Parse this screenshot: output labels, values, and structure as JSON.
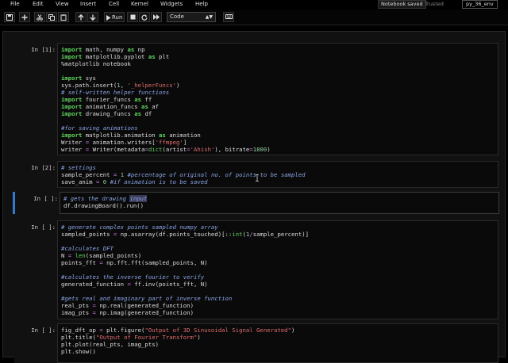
{
  "menubar": {
    "items": [
      "File",
      "Edit",
      "View",
      "Insert",
      "Cell",
      "Kernel",
      "Widgets",
      "Help"
    ],
    "notebook_status": "Notebook saved",
    "trusted": "Trusted",
    "kernel": "py_36_env"
  },
  "toolbar": {
    "run_label": "Run",
    "cell_type": "Code",
    "icons": [
      "save-icon",
      "add-cell-icon",
      "cut-icon",
      "copy-icon",
      "paste-icon",
      "move-up-icon",
      "move-down-icon",
      "run-icon",
      "stop-icon",
      "restart-icon",
      "fast-forward-icon",
      "keyboard-icon"
    ]
  },
  "cells": [
    {
      "prompt": "In [1]:",
      "lines": [
        [
          [
            "kw",
            "import"
          ],
          [
            "t",
            " math, numpy "
          ],
          [
            "kw",
            "as"
          ],
          [
            "t",
            " np"
          ]
        ],
        [
          [
            "kw",
            "import"
          ],
          [
            "t",
            " matplotlib.pyplot "
          ],
          [
            "kw",
            "as"
          ],
          [
            "t",
            " plt"
          ]
        ],
        [
          [
            "t",
            "%matplotlib notebook"
          ]
        ],
        [],
        [
          [
            "kw",
            "import"
          ],
          [
            "t",
            " sys"
          ]
        ],
        [
          [
            "t",
            "sys.path.insert("
          ],
          [
            "nm",
            "1"
          ],
          [
            "t",
            ", "
          ],
          [
            "st",
            "'_helperFuncs'"
          ],
          [
            "t",
            ")"
          ]
        ],
        [
          [
            "cm",
            "# self-written helper functions"
          ]
        ],
        [
          [
            "kw",
            "import"
          ],
          [
            "t",
            " fourier_funcs "
          ],
          [
            "kw",
            "as"
          ],
          [
            "t",
            " ff"
          ]
        ],
        [
          [
            "kw",
            "import"
          ],
          [
            "t",
            " animation_funcs "
          ],
          [
            "kw",
            "as"
          ],
          [
            "t",
            " af"
          ]
        ],
        [
          [
            "kw",
            "import"
          ],
          [
            "t",
            " drawing_funcs "
          ],
          [
            "kw",
            "as"
          ],
          [
            "t",
            " df"
          ]
        ],
        [],
        [
          [
            "cm",
            "#for saving animations"
          ]
        ],
        [
          [
            "kw",
            "import"
          ],
          [
            "t",
            " matplotlib.animation "
          ],
          [
            "kw",
            "as"
          ],
          [
            "t",
            " animation"
          ]
        ],
        [
          [
            "t",
            "Writer "
          ],
          [
            "op",
            "="
          ],
          [
            "t",
            " animation.writers["
          ],
          [
            "st",
            "'ffmpeg'"
          ],
          [
            "t",
            "]"
          ]
        ],
        [
          [
            "t",
            "writer "
          ],
          [
            "op",
            "="
          ],
          [
            "t",
            " Writer(metadata"
          ],
          [
            "op",
            "="
          ],
          [
            "bi",
            "dict"
          ],
          [
            "t",
            "(artist"
          ],
          [
            "op",
            "="
          ],
          [
            "st",
            "'Ahish'"
          ],
          [
            "t",
            "), bitrate"
          ],
          [
            "op",
            "="
          ],
          [
            "nm",
            "1800"
          ],
          [
            "t",
            ")"
          ]
        ]
      ]
    },
    {
      "prompt": "In [2]:",
      "lines": [
        [
          [
            "cm",
            "# settings"
          ]
        ],
        [
          [
            "t",
            "sample_percent "
          ],
          [
            "op",
            "="
          ],
          [
            "t",
            " "
          ],
          [
            "nm",
            "1"
          ],
          [
            "t",
            " "
          ],
          [
            "cm",
            "#percentage of original no. of points to be sampled"
          ]
        ],
        [
          [
            "t",
            "save_anim "
          ],
          [
            "op",
            "="
          ],
          [
            "t",
            " "
          ],
          [
            "nm",
            "0"
          ],
          [
            "t",
            " "
          ],
          [
            "cm",
            "#if animation is to be saved"
          ]
        ]
      ]
    },
    {
      "prompt": "In [ ]:",
      "selected": true,
      "lines": [
        [
          [
            "cm",
            "# gets the drawing "
          ],
          [
            "cmhl",
            "input"
          ]
        ],
        [
          [
            "t",
            "df.drawingBoard().run()"
          ]
        ]
      ]
    },
    {
      "prompt": "In [ ]:",
      "lines": [
        [
          [
            "cm",
            "# generate complex points sampled numpy array"
          ]
        ],
        [
          [
            "t",
            "sampled_points "
          ],
          [
            "op",
            "="
          ],
          [
            "t",
            " np.asarray(df.points_touched)[::"
          ],
          [
            "bi",
            "int"
          ],
          [
            "t",
            "("
          ],
          [
            "nm",
            "1"
          ],
          [
            "op",
            "/"
          ],
          [
            "t",
            "sample_percent)]"
          ]
        ],
        [],
        [
          [
            "cm",
            "#calculates DFT"
          ]
        ],
        [
          [
            "t",
            "N "
          ],
          [
            "op",
            "="
          ],
          [
            "t",
            " "
          ],
          [
            "bi",
            "len"
          ],
          [
            "t",
            "(sampled_points)"
          ]
        ],
        [
          [
            "t",
            "points_fft "
          ],
          [
            "op",
            "="
          ],
          [
            "t",
            " np.fft.fft(sampled_points, N)"
          ]
        ],
        [],
        [
          [
            "cm",
            "#calculates the inverse fourier to verify"
          ]
        ],
        [
          [
            "t",
            "generated_function "
          ],
          [
            "op",
            "="
          ],
          [
            "t",
            " ff.inv(points_fft, N)"
          ]
        ],
        [],
        [
          [
            "cm",
            "#gets real and imaginary part of inverse function"
          ]
        ],
        [
          [
            "t",
            "real_pts "
          ],
          [
            "op",
            "="
          ],
          [
            "t",
            " np.real(generated_function)"
          ]
        ],
        [
          [
            "t",
            "imag_pts "
          ],
          [
            "op",
            "="
          ],
          [
            "t",
            " np.imag(generated_function)"
          ]
        ]
      ]
    },
    {
      "prompt": "In [ ]:",
      "lines": [
        [
          [
            "t",
            "fig_dft_op "
          ],
          [
            "op",
            "="
          ],
          [
            "t",
            " plt.figure("
          ],
          [
            "st",
            "\"Output of 3D Sinusoidal Signal Generated\""
          ],
          [
            "t",
            ")"
          ]
        ],
        [
          [
            "t",
            "plt.title("
          ],
          [
            "st",
            "\"Output of Fourier Transform\""
          ],
          [
            "t",
            ")"
          ]
        ],
        [
          [
            "t",
            "plt.plot(real_pts, imag_pts)"
          ]
        ],
        [
          [
            "t",
            "plt.show()"
          ]
        ]
      ]
    }
  ]
}
